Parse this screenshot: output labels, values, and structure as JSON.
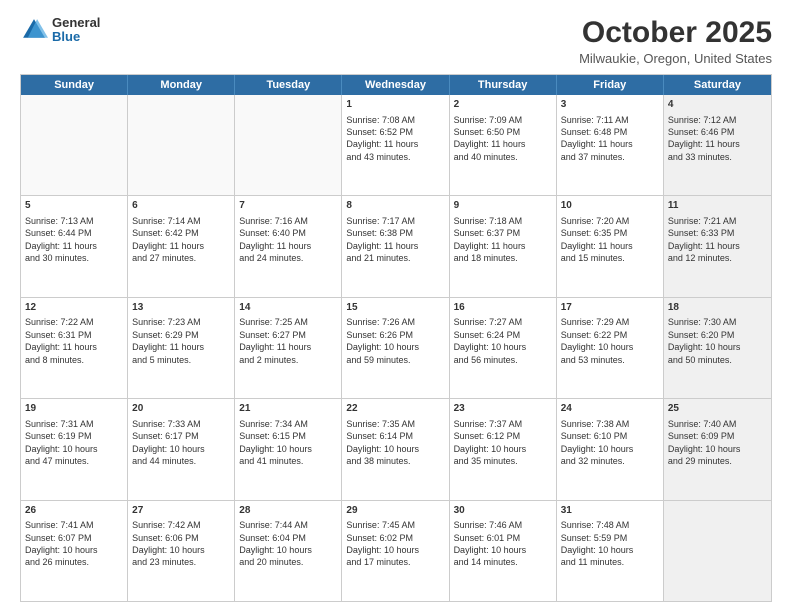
{
  "header": {
    "logo_general": "General",
    "logo_blue": "Blue",
    "title": "October 2025",
    "location": "Milwaukie, Oregon, United States"
  },
  "days_of_week": [
    "Sunday",
    "Monday",
    "Tuesday",
    "Wednesday",
    "Thursday",
    "Friday",
    "Saturday"
  ],
  "weeks": [
    [
      {
        "day": "",
        "empty": true,
        "shaded": false,
        "lines": []
      },
      {
        "day": "",
        "empty": true,
        "shaded": false,
        "lines": []
      },
      {
        "day": "",
        "empty": true,
        "shaded": false,
        "lines": []
      },
      {
        "day": "1",
        "empty": false,
        "shaded": false,
        "lines": [
          "Sunrise: 7:08 AM",
          "Sunset: 6:52 PM",
          "Daylight: 11 hours",
          "and 43 minutes."
        ]
      },
      {
        "day": "2",
        "empty": false,
        "shaded": false,
        "lines": [
          "Sunrise: 7:09 AM",
          "Sunset: 6:50 PM",
          "Daylight: 11 hours",
          "and 40 minutes."
        ]
      },
      {
        "day": "3",
        "empty": false,
        "shaded": false,
        "lines": [
          "Sunrise: 7:11 AM",
          "Sunset: 6:48 PM",
          "Daylight: 11 hours",
          "and 37 minutes."
        ]
      },
      {
        "day": "4",
        "empty": false,
        "shaded": true,
        "lines": [
          "Sunrise: 7:12 AM",
          "Sunset: 6:46 PM",
          "Daylight: 11 hours",
          "and 33 minutes."
        ]
      }
    ],
    [
      {
        "day": "5",
        "empty": false,
        "shaded": false,
        "lines": [
          "Sunrise: 7:13 AM",
          "Sunset: 6:44 PM",
          "Daylight: 11 hours",
          "and 30 minutes."
        ]
      },
      {
        "day": "6",
        "empty": false,
        "shaded": false,
        "lines": [
          "Sunrise: 7:14 AM",
          "Sunset: 6:42 PM",
          "Daylight: 11 hours",
          "and 27 minutes."
        ]
      },
      {
        "day": "7",
        "empty": false,
        "shaded": false,
        "lines": [
          "Sunrise: 7:16 AM",
          "Sunset: 6:40 PM",
          "Daylight: 11 hours",
          "and 24 minutes."
        ]
      },
      {
        "day": "8",
        "empty": false,
        "shaded": false,
        "lines": [
          "Sunrise: 7:17 AM",
          "Sunset: 6:38 PM",
          "Daylight: 11 hours",
          "and 21 minutes."
        ]
      },
      {
        "day": "9",
        "empty": false,
        "shaded": false,
        "lines": [
          "Sunrise: 7:18 AM",
          "Sunset: 6:37 PM",
          "Daylight: 11 hours",
          "and 18 minutes."
        ]
      },
      {
        "day": "10",
        "empty": false,
        "shaded": false,
        "lines": [
          "Sunrise: 7:20 AM",
          "Sunset: 6:35 PM",
          "Daylight: 11 hours",
          "and 15 minutes."
        ]
      },
      {
        "day": "11",
        "empty": false,
        "shaded": true,
        "lines": [
          "Sunrise: 7:21 AM",
          "Sunset: 6:33 PM",
          "Daylight: 11 hours",
          "and 12 minutes."
        ]
      }
    ],
    [
      {
        "day": "12",
        "empty": false,
        "shaded": false,
        "lines": [
          "Sunrise: 7:22 AM",
          "Sunset: 6:31 PM",
          "Daylight: 11 hours",
          "and 8 minutes."
        ]
      },
      {
        "day": "13",
        "empty": false,
        "shaded": false,
        "lines": [
          "Sunrise: 7:23 AM",
          "Sunset: 6:29 PM",
          "Daylight: 11 hours",
          "and 5 minutes."
        ]
      },
      {
        "day": "14",
        "empty": false,
        "shaded": false,
        "lines": [
          "Sunrise: 7:25 AM",
          "Sunset: 6:27 PM",
          "Daylight: 11 hours",
          "and 2 minutes."
        ]
      },
      {
        "day": "15",
        "empty": false,
        "shaded": false,
        "lines": [
          "Sunrise: 7:26 AM",
          "Sunset: 6:26 PM",
          "Daylight: 10 hours",
          "and 59 minutes."
        ]
      },
      {
        "day": "16",
        "empty": false,
        "shaded": false,
        "lines": [
          "Sunrise: 7:27 AM",
          "Sunset: 6:24 PM",
          "Daylight: 10 hours",
          "and 56 minutes."
        ]
      },
      {
        "day": "17",
        "empty": false,
        "shaded": false,
        "lines": [
          "Sunrise: 7:29 AM",
          "Sunset: 6:22 PM",
          "Daylight: 10 hours",
          "and 53 minutes."
        ]
      },
      {
        "day": "18",
        "empty": false,
        "shaded": true,
        "lines": [
          "Sunrise: 7:30 AM",
          "Sunset: 6:20 PM",
          "Daylight: 10 hours",
          "and 50 minutes."
        ]
      }
    ],
    [
      {
        "day": "19",
        "empty": false,
        "shaded": false,
        "lines": [
          "Sunrise: 7:31 AM",
          "Sunset: 6:19 PM",
          "Daylight: 10 hours",
          "and 47 minutes."
        ]
      },
      {
        "day": "20",
        "empty": false,
        "shaded": false,
        "lines": [
          "Sunrise: 7:33 AM",
          "Sunset: 6:17 PM",
          "Daylight: 10 hours",
          "and 44 minutes."
        ]
      },
      {
        "day": "21",
        "empty": false,
        "shaded": false,
        "lines": [
          "Sunrise: 7:34 AM",
          "Sunset: 6:15 PM",
          "Daylight: 10 hours",
          "and 41 minutes."
        ]
      },
      {
        "day": "22",
        "empty": false,
        "shaded": false,
        "lines": [
          "Sunrise: 7:35 AM",
          "Sunset: 6:14 PM",
          "Daylight: 10 hours",
          "and 38 minutes."
        ]
      },
      {
        "day": "23",
        "empty": false,
        "shaded": false,
        "lines": [
          "Sunrise: 7:37 AM",
          "Sunset: 6:12 PM",
          "Daylight: 10 hours",
          "and 35 minutes."
        ]
      },
      {
        "day": "24",
        "empty": false,
        "shaded": false,
        "lines": [
          "Sunrise: 7:38 AM",
          "Sunset: 6:10 PM",
          "Daylight: 10 hours",
          "and 32 minutes."
        ]
      },
      {
        "day": "25",
        "empty": false,
        "shaded": true,
        "lines": [
          "Sunrise: 7:40 AM",
          "Sunset: 6:09 PM",
          "Daylight: 10 hours",
          "and 29 minutes."
        ]
      }
    ],
    [
      {
        "day": "26",
        "empty": false,
        "shaded": false,
        "lines": [
          "Sunrise: 7:41 AM",
          "Sunset: 6:07 PM",
          "Daylight: 10 hours",
          "and 26 minutes."
        ]
      },
      {
        "day": "27",
        "empty": false,
        "shaded": false,
        "lines": [
          "Sunrise: 7:42 AM",
          "Sunset: 6:06 PM",
          "Daylight: 10 hours",
          "and 23 minutes."
        ]
      },
      {
        "day": "28",
        "empty": false,
        "shaded": false,
        "lines": [
          "Sunrise: 7:44 AM",
          "Sunset: 6:04 PM",
          "Daylight: 10 hours",
          "and 20 minutes."
        ]
      },
      {
        "day": "29",
        "empty": false,
        "shaded": false,
        "lines": [
          "Sunrise: 7:45 AM",
          "Sunset: 6:02 PM",
          "Daylight: 10 hours",
          "and 17 minutes."
        ]
      },
      {
        "day": "30",
        "empty": false,
        "shaded": false,
        "lines": [
          "Sunrise: 7:46 AM",
          "Sunset: 6:01 PM",
          "Daylight: 10 hours",
          "and 14 minutes."
        ]
      },
      {
        "day": "31",
        "empty": false,
        "shaded": false,
        "lines": [
          "Sunrise: 7:48 AM",
          "Sunset: 5:59 PM",
          "Daylight: 10 hours",
          "and 11 minutes."
        ]
      },
      {
        "day": "",
        "empty": true,
        "shaded": true,
        "lines": []
      }
    ]
  ]
}
